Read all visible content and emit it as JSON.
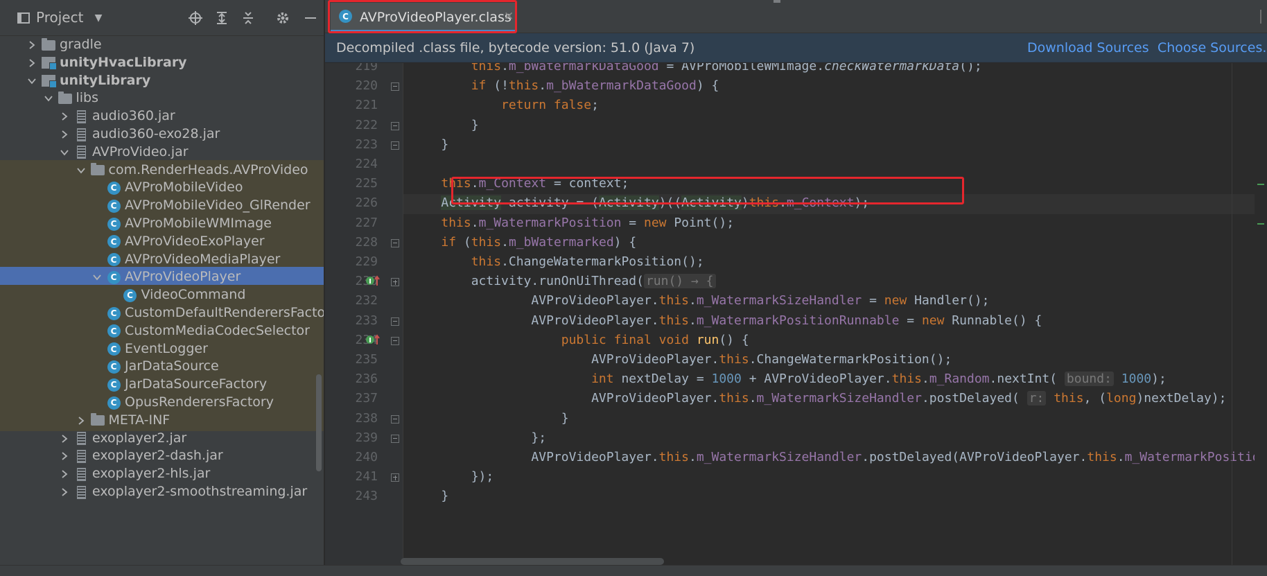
{
  "project_panel": {
    "title": "Project",
    "tree": [
      {
        "label": "gradle",
        "icon": "folder-icon",
        "depth": 0,
        "expanded": false,
        "bold": false
      },
      {
        "label": "unityHvacLibrary",
        "icon": "module-icon",
        "depth": 0,
        "expanded": false,
        "bold": true
      },
      {
        "label": "unityLibrary",
        "icon": "module-icon",
        "depth": 0,
        "expanded": true,
        "bold": true
      },
      {
        "label": "libs",
        "icon": "folder-icon",
        "depth": 1,
        "expanded": true,
        "bold": false
      },
      {
        "label": "audio360.jar",
        "icon": "jar-icon",
        "depth": 2,
        "expanded": false,
        "bold": false
      },
      {
        "label": "audio360-exo28.jar",
        "icon": "jar-icon",
        "depth": 2,
        "expanded": false,
        "bold": false
      },
      {
        "label": "AVProVideo.jar",
        "icon": "jar-icon",
        "depth": 2,
        "expanded": true,
        "bold": false
      },
      {
        "label": "com.RenderHeads.AVProVideo",
        "icon": "folder-icon",
        "depth": 3,
        "expanded": true,
        "bold": false
      },
      {
        "label": "AVProMobileVideo",
        "icon": "class-icon",
        "depth": 4,
        "bold": false
      },
      {
        "label": "AVProMobileVideo_GlRender",
        "icon": "class-icon",
        "depth": 4,
        "bold": false
      },
      {
        "label": "AVProMobileWMImage",
        "icon": "class-icon",
        "depth": 4,
        "bold": false
      },
      {
        "label": "AVProVideoExoPlayer",
        "icon": "class-icon",
        "depth": 4,
        "bold": false
      },
      {
        "label": "AVProVideoMediaPlayer",
        "icon": "class-icon",
        "depth": 4,
        "bold": false
      },
      {
        "label": "AVProVideoPlayer",
        "icon": "class-icon",
        "depth": 4,
        "expanded": true,
        "bold": false,
        "selected": true
      },
      {
        "label": "VideoCommand",
        "icon": "class-icon",
        "depth": 5,
        "bold": false
      },
      {
        "label": "CustomDefaultRenderersFactory",
        "icon": "class-icon",
        "depth": 4,
        "bold": false
      },
      {
        "label": "CustomMediaCodecSelector",
        "icon": "class-icon",
        "depth": 4,
        "bold": false
      },
      {
        "label": "EventLogger",
        "icon": "class-icon",
        "depth": 4,
        "bold": false
      },
      {
        "label": "JarDataSource",
        "icon": "class-icon",
        "depth": 4,
        "bold": false
      },
      {
        "label": "JarDataSourceFactory",
        "icon": "class-icon",
        "depth": 4,
        "bold": false
      },
      {
        "label": "OpusRenderersFactory",
        "icon": "class-icon",
        "depth": 4,
        "bold": false
      },
      {
        "label": "META-INF",
        "icon": "folder-icon",
        "depth": 3,
        "expanded": false,
        "bold": false
      },
      {
        "label": "exoplayer2.jar",
        "icon": "jar-icon",
        "depth": 2,
        "expanded": false,
        "bold": false
      },
      {
        "label": "exoplayer2-dash.jar",
        "icon": "jar-icon",
        "depth": 2,
        "expanded": false,
        "bold": false
      },
      {
        "label": "exoplayer2-hls.jar",
        "icon": "jar-icon",
        "depth": 2,
        "expanded": false,
        "bold": false
      },
      {
        "label": "exoplayer2-smoothstreaming.jar",
        "icon": "jar-icon",
        "depth": 2,
        "expanded": false,
        "bold": false
      }
    ]
  },
  "editor": {
    "tab_label": "AVProVideoPlayer.class",
    "tab_icon_glyph": "C",
    "banner_text": "Decompiled .class file, bytecode version: 51.0 (Java 7)",
    "download_sources": "Download Sources",
    "choose_sources": "Choose Sources...",
    "lines": [
      {
        "no": "219",
        "html": "        <span class=\"kw\">this</span>.<span class=\"fld\">m_bWatermarkDataGood</span> = AVProMobileWMImage.<span class=\"ital\">checkWatermarkData</span>();"
      },
      {
        "no": "220",
        "html": "        <span class=\"kw\">if</span> (!<span class=\"kw\">this</span>.<span class=\"fld\">m_bWatermarkDataGood</span>) {"
      },
      {
        "no": "221",
        "html": "            <span class=\"kw\">return false</span>;"
      },
      {
        "no": "222",
        "html": "        }"
      },
      {
        "no": "223",
        "html": "    }"
      },
      {
        "no": "224",
        "html": ""
      },
      {
        "no": "225",
        "html": "    <span class=\"kw\">this</span>.<span class=\"fld\">m_Context</span> = context;"
      },
      {
        "no": "226",
        "html": "    <span class=\"hl\">Activity</span> activity = (<span class=\"hl\">Activity</span>)((<span class=\"hl\">Activity</span>)<span class=\"kw\">this</span>.<span class=\"fld\">m_Context</span>);"
      },
      {
        "no": "227",
        "html": "    <span class=\"kw\">this</span>.<span class=\"fld\">m_WatermarkPosition</span> = <span class=\"kw\">new</span> Point();"
      },
      {
        "no": "228",
        "html": "    <span class=\"kw\">if</span> (<span class=\"kw\">this</span>.<span class=\"fld\">m_bWatermarked</span>) {"
      },
      {
        "no": "229",
        "html": "        <span class=\"kw\">this</span>.ChangeWatermarkPosition();"
      },
      {
        "no": "230",
        "html": "        activity.runOnUiThread(<span class=\"hint\">run() → {</span>"
      },
      {
        "no": "232",
        "html": "                AVProVideoPlayer.<span class=\"kw\">this</span>.<span class=\"fld\">m_WatermarkSizeHandler</span> = <span class=\"kw\">new</span> Handler();"
      },
      {
        "no": "233",
        "html": "                AVProVideoPlayer.<span class=\"kw\">this</span>.<span class=\"fld\">m_WatermarkPositionRunnable</span> = <span class=\"kw\">new</span> Runnable() {"
      },
      {
        "no": "234",
        "html": "                    <span class=\"kw\">public final void</span> <span class=\"fn\">run</span>() {"
      },
      {
        "no": "235",
        "html": "                        AVProVideoPlayer.<span class=\"kw\">this</span>.ChangeWatermarkPosition();"
      },
      {
        "no": "236",
        "html": "                        <span class=\"kw\">int</span> nextDelay = <span class=\"num\">1000</span> + AVProVideoPlayer.<span class=\"kw\">this</span>.<span class=\"fld\">m_Random</span>.nextInt( <span class=\"hint\">bound:</span> <span class=\"num\">1000</span>);"
      },
      {
        "no": "237",
        "html": "                        AVProVideoPlayer.<span class=\"kw\">this</span>.<span class=\"fld\">m_WatermarkSizeHandler</span>.postDelayed( <span class=\"hint\">r:</span> <span class=\"kw\">this</span>, (<span class=\"kw\">long</span>)nextDelay);"
      },
      {
        "no": "238",
        "html": "                    }"
      },
      {
        "no": "239",
        "html": "                };"
      },
      {
        "no": "240",
        "html": "                AVProVideoPlayer.<span class=\"kw\">this</span>.<span class=\"fld\">m_WatermarkSizeHandler</span>.postDelayed(AVProVideoPlayer.<span class=\"kw\">this</span>.<span class=\"fld\">m_WatermarkPositionRunnable</span>"
      },
      {
        "no": "241",
        "html": "        });"
      },
      {
        "no": "243",
        "html": "    }"
      }
    ]
  }
}
